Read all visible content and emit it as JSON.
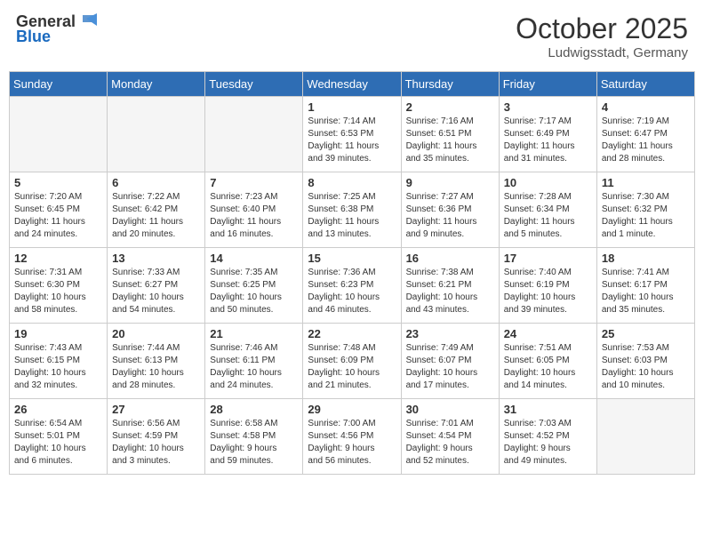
{
  "header": {
    "logo_general": "General",
    "logo_blue": "Blue",
    "month": "October 2025",
    "location": "Ludwigsstadt, Germany"
  },
  "days_of_week": [
    "Sunday",
    "Monday",
    "Tuesday",
    "Wednesday",
    "Thursday",
    "Friday",
    "Saturday"
  ],
  "weeks": [
    [
      {
        "day": "",
        "info": ""
      },
      {
        "day": "",
        "info": ""
      },
      {
        "day": "",
        "info": ""
      },
      {
        "day": "1",
        "info": "Sunrise: 7:14 AM\nSunset: 6:53 PM\nDaylight: 11 hours\nand 39 minutes."
      },
      {
        "day": "2",
        "info": "Sunrise: 7:16 AM\nSunset: 6:51 PM\nDaylight: 11 hours\nand 35 minutes."
      },
      {
        "day": "3",
        "info": "Sunrise: 7:17 AM\nSunset: 6:49 PM\nDaylight: 11 hours\nand 31 minutes."
      },
      {
        "day": "4",
        "info": "Sunrise: 7:19 AM\nSunset: 6:47 PM\nDaylight: 11 hours\nand 28 minutes."
      }
    ],
    [
      {
        "day": "5",
        "info": "Sunrise: 7:20 AM\nSunset: 6:45 PM\nDaylight: 11 hours\nand 24 minutes."
      },
      {
        "day": "6",
        "info": "Sunrise: 7:22 AM\nSunset: 6:42 PM\nDaylight: 11 hours\nand 20 minutes."
      },
      {
        "day": "7",
        "info": "Sunrise: 7:23 AM\nSunset: 6:40 PM\nDaylight: 11 hours\nand 16 minutes."
      },
      {
        "day": "8",
        "info": "Sunrise: 7:25 AM\nSunset: 6:38 PM\nDaylight: 11 hours\nand 13 minutes."
      },
      {
        "day": "9",
        "info": "Sunrise: 7:27 AM\nSunset: 6:36 PM\nDaylight: 11 hours\nand 9 minutes."
      },
      {
        "day": "10",
        "info": "Sunrise: 7:28 AM\nSunset: 6:34 PM\nDaylight: 11 hours\nand 5 minutes."
      },
      {
        "day": "11",
        "info": "Sunrise: 7:30 AM\nSunset: 6:32 PM\nDaylight: 11 hours\nand 1 minute."
      }
    ],
    [
      {
        "day": "12",
        "info": "Sunrise: 7:31 AM\nSunset: 6:30 PM\nDaylight: 10 hours\nand 58 minutes."
      },
      {
        "day": "13",
        "info": "Sunrise: 7:33 AM\nSunset: 6:27 PM\nDaylight: 10 hours\nand 54 minutes."
      },
      {
        "day": "14",
        "info": "Sunrise: 7:35 AM\nSunset: 6:25 PM\nDaylight: 10 hours\nand 50 minutes."
      },
      {
        "day": "15",
        "info": "Sunrise: 7:36 AM\nSunset: 6:23 PM\nDaylight: 10 hours\nand 46 minutes."
      },
      {
        "day": "16",
        "info": "Sunrise: 7:38 AM\nSunset: 6:21 PM\nDaylight: 10 hours\nand 43 minutes."
      },
      {
        "day": "17",
        "info": "Sunrise: 7:40 AM\nSunset: 6:19 PM\nDaylight: 10 hours\nand 39 minutes."
      },
      {
        "day": "18",
        "info": "Sunrise: 7:41 AM\nSunset: 6:17 PM\nDaylight: 10 hours\nand 35 minutes."
      }
    ],
    [
      {
        "day": "19",
        "info": "Sunrise: 7:43 AM\nSunset: 6:15 PM\nDaylight: 10 hours\nand 32 minutes."
      },
      {
        "day": "20",
        "info": "Sunrise: 7:44 AM\nSunset: 6:13 PM\nDaylight: 10 hours\nand 28 minutes."
      },
      {
        "day": "21",
        "info": "Sunrise: 7:46 AM\nSunset: 6:11 PM\nDaylight: 10 hours\nand 24 minutes."
      },
      {
        "day": "22",
        "info": "Sunrise: 7:48 AM\nSunset: 6:09 PM\nDaylight: 10 hours\nand 21 minutes."
      },
      {
        "day": "23",
        "info": "Sunrise: 7:49 AM\nSunset: 6:07 PM\nDaylight: 10 hours\nand 17 minutes."
      },
      {
        "day": "24",
        "info": "Sunrise: 7:51 AM\nSunset: 6:05 PM\nDaylight: 10 hours\nand 14 minutes."
      },
      {
        "day": "25",
        "info": "Sunrise: 7:53 AM\nSunset: 6:03 PM\nDaylight: 10 hours\nand 10 minutes."
      }
    ],
    [
      {
        "day": "26",
        "info": "Sunrise: 6:54 AM\nSunset: 5:01 PM\nDaylight: 10 hours\nand 6 minutes."
      },
      {
        "day": "27",
        "info": "Sunrise: 6:56 AM\nSunset: 4:59 PM\nDaylight: 10 hours\nand 3 minutes."
      },
      {
        "day": "28",
        "info": "Sunrise: 6:58 AM\nSunset: 4:58 PM\nDaylight: 9 hours\nand 59 minutes."
      },
      {
        "day": "29",
        "info": "Sunrise: 7:00 AM\nSunset: 4:56 PM\nDaylight: 9 hours\nand 56 minutes."
      },
      {
        "day": "30",
        "info": "Sunrise: 7:01 AM\nSunset: 4:54 PM\nDaylight: 9 hours\nand 52 minutes."
      },
      {
        "day": "31",
        "info": "Sunrise: 7:03 AM\nSunset: 4:52 PM\nDaylight: 9 hours\nand 49 minutes."
      },
      {
        "day": "",
        "info": ""
      }
    ]
  ]
}
